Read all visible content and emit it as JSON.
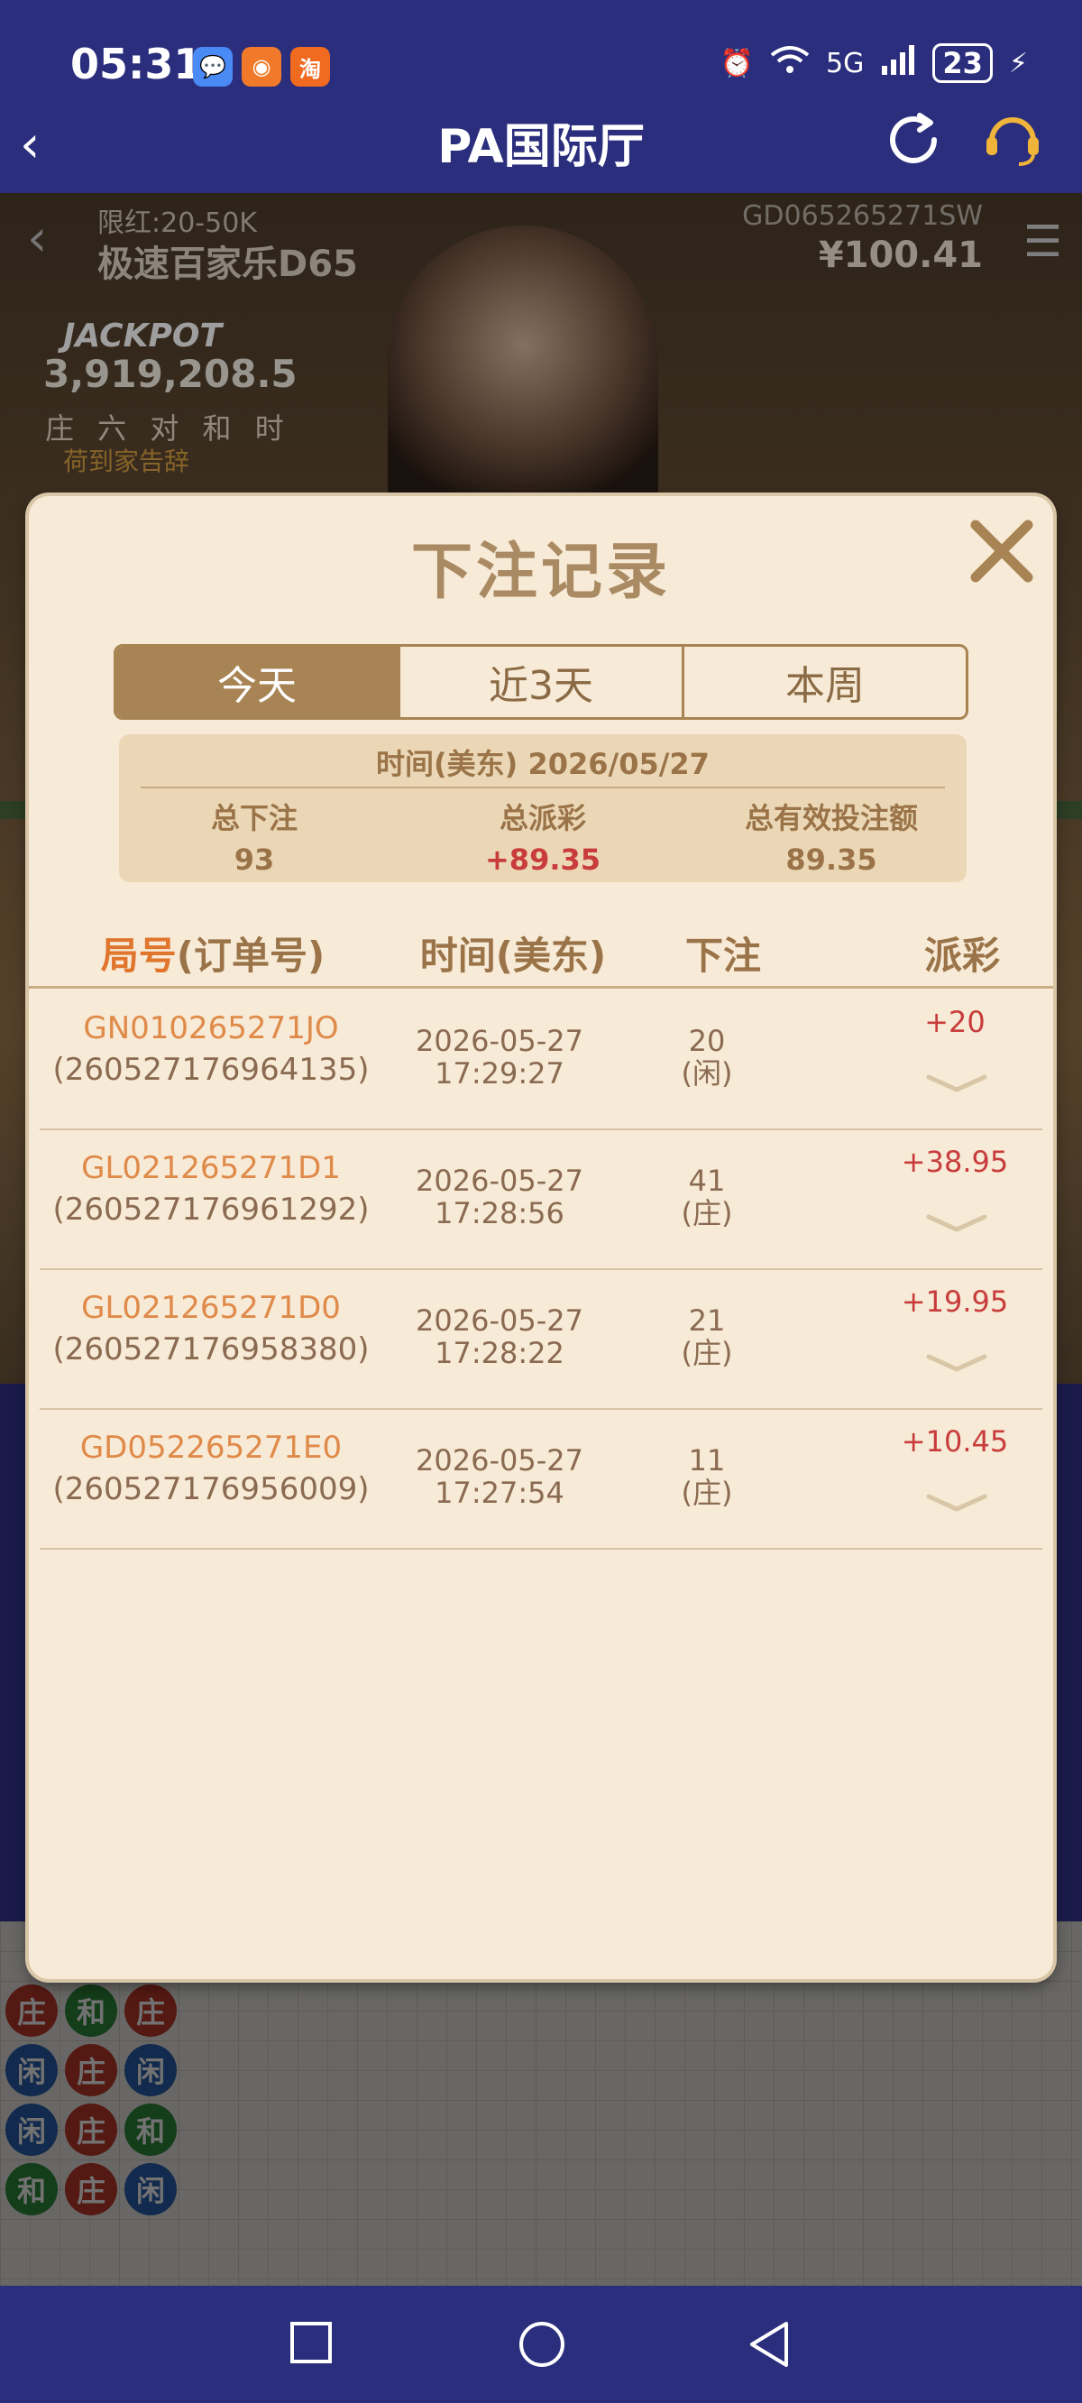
{
  "status_bar": {
    "time": "05:31",
    "apps": [
      {
        "icon": "message-app-icon",
        "color": "#4a8af4",
        "glyph": "💬"
      },
      {
        "icon": "shop-app-icon",
        "color": "#f07a2a",
        "glyph": "◉"
      },
      {
        "icon": "taobao-app-icon",
        "color": "#f06a20",
        "glyph": "淘"
      }
    ],
    "network": "5G",
    "battery": "23"
  },
  "navbar": {
    "back_symbol": "‹",
    "title": "PA国际厅"
  },
  "game": {
    "limit": "限红:20-50K",
    "table_name": "极速百家乐D65",
    "table_id": "GD065265271SW",
    "balance": "¥100.41",
    "jackpot_label": "JACKPOT",
    "jackpot_value": "3,919,208.5",
    "bet_types": "庄 六 对 和 时",
    "exit_text": "荷到家告辞"
  },
  "modal": {
    "title": "下注记录",
    "tabs": [
      {
        "label": "今天",
        "active": true
      },
      {
        "label": "近3天",
        "active": false
      },
      {
        "label": "本周",
        "active": false
      }
    ],
    "summary": {
      "header": "时间(美东) 2026/05/27",
      "total_bet_label": "总下注",
      "total_bet": "93",
      "total_payout_label": "总派彩",
      "total_payout": "+89.35",
      "valid_bet_label": "总有效投注额",
      "valid_bet": "89.35"
    },
    "columns": {
      "id_prefix": "局号",
      "id_suffix": "(订单号)",
      "time": "时间(美东)",
      "bet": "下注",
      "payout": "派彩"
    },
    "rows": [
      {
        "code": "GN010265271JO",
        "order": "(260527176964135)",
        "date": "2026-05-27",
        "time": "17:29:27",
        "bet": "20",
        "side": "(闲)",
        "payout": "+20"
      },
      {
        "code": "GL021265271D1",
        "order": "(260527176961292)",
        "date": "2026-05-27",
        "time": "17:28:56",
        "bet": "41",
        "side": "(庄)",
        "payout": "+38.95"
      },
      {
        "code": "GL021265271D0",
        "order": "(260527176958380)",
        "date": "2026-05-27",
        "time": "17:28:22",
        "bet": "21",
        "side": "(庄)",
        "payout": "+19.95"
      },
      {
        "code": "GD052265271E0",
        "order": "(260527176956009)",
        "date": "2026-05-27",
        "time": "17:27:54",
        "bet": "11",
        "side": "(庄)",
        "payout": "+10.45"
      }
    ]
  },
  "roadmap": {
    "beads": [
      [
        "庄",
        "b"
      ],
      [
        "和",
        "t"
      ],
      [
        "庄",
        "b"
      ],
      [
        "闲",
        "p"
      ],
      [
        "庄",
        "b"
      ],
      [
        "闲",
        "p"
      ],
      [
        "闲",
        "p"
      ],
      [
        "庄",
        "b"
      ],
      [
        "和",
        "t"
      ],
      [
        "和",
        "t"
      ],
      [
        "庄",
        "b"
      ],
      [
        "闲",
        "p"
      ]
    ]
  },
  "colors": {
    "header_bg": "#2b2e7d",
    "modal_bg": "#f7ead6",
    "accent_gold": "#a88454",
    "payout_red": "#c83c3c",
    "id_orange": "#e08a4a"
  }
}
